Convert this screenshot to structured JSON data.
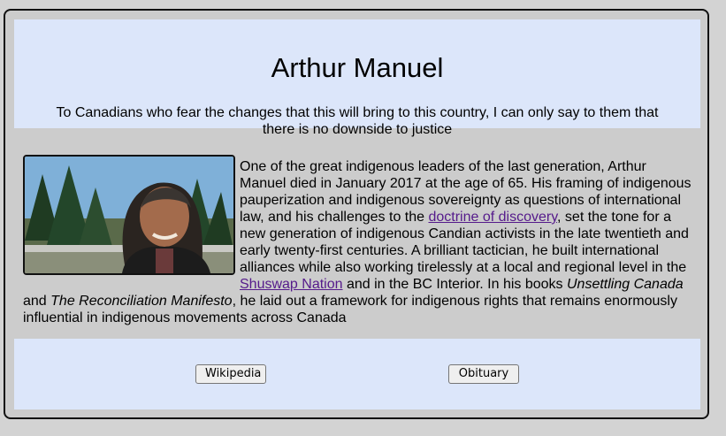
{
  "person": {
    "name": "Arthur Manuel",
    "quote": "To Canadians who fear the changes that this will bring to this country, I can only say to them that there is no downside to justice"
  },
  "bio": {
    "part1": "One of the great indigenous leaders of the last generation, Arthur Manuel died in January 2017 at the age of 65. His framing of indigenous pauperization and indigenous sovereignty as questions of international law, and his challenges to the ",
    "link1": "doctrine of discovery",
    "part2": ", set the tone for a new generation of indigenous Candian activists in the late twentieth and early twenty-first centuries. A brilliant tactician, he built international alliances while also working tirelessly at a local and regional level in the ",
    "link2": "Shuswap Nation",
    "part3": " and in the BC Interior. In his books ",
    "book1": "Unsettling Canada",
    "part4": " and ",
    "book2": "The Reconciliation Manifesto",
    "part5": ", he laid out a framework for indigenous rights that remains enormously influential in indigenous movements across Canada"
  },
  "buttons": {
    "wikipedia": "Wikipedia",
    "obituary": "Obituary"
  }
}
